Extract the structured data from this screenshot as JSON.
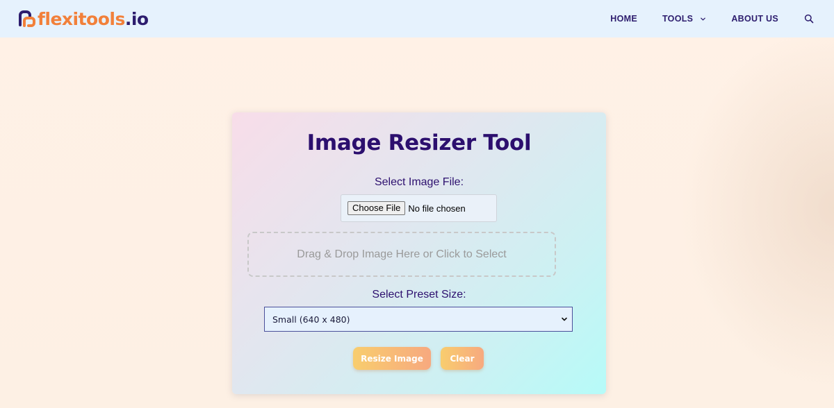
{
  "header": {
    "logo": {
      "brand": "flexitools",
      "tld": ".io"
    },
    "nav": [
      {
        "label": "HOME",
        "has_dropdown": false
      },
      {
        "label": "TOOLS",
        "has_dropdown": true
      },
      {
        "label": "ABOUT US",
        "has_dropdown": false
      }
    ],
    "search_icon": "search-icon"
  },
  "tool": {
    "title": "Image Resizer Tool",
    "file_label": "Select Image File:",
    "choose_file_button": "Choose File",
    "file_status": "No file chosen",
    "dropzone_text": "Drag & Drop Image Here or Click to Select",
    "preset_label": "Select Preset Size:",
    "preset_selected": "Small (640 x 480)",
    "resize_button": "Resize Image",
    "clear_button": "Clear"
  },
  "colors": {
    "brand_orange": "#f2803a",
    "brand_navy": "#2d1d6e",
    "header_bg": "#e6f2fd",
    "title_purple": "#2c0f6e",
    "button_gradient_start": "#f8cd6e",
    "button_gradient_end": "#f7a97f"
  }
}
